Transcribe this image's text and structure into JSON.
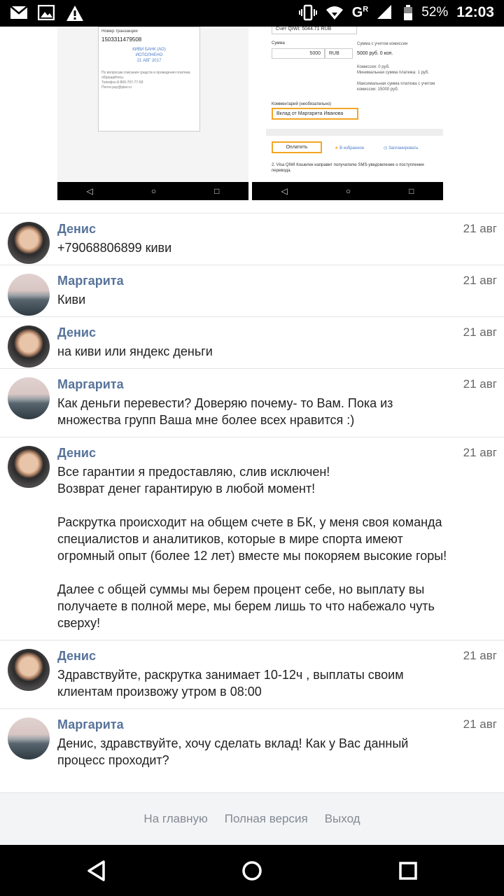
{
  "status_bar": {
    "battery": "52%",
    "time": "12:03",
    "network": "G",
    "network_sup": "R"
  },
  "attachment": {
    "left": {
      "label_top": "Номер транзакции",
      "number": "1503311479508",
      "bank": "КИВИ БАНК (АО)",
      "status": "ИСПОЛНЕНО",
      "date": "21 АВГ 2017",
      "support": "По вопросам списания средств и проведения платежа обращайтесь:",
      "phone_label": "Телефон",
      "phone": "8-800-707-77-59",
      "mail_label": "Почта",
      "mail": "pay@qiwi.ru"
    },
    "right": {
      "account": "Счет QIWI: 5044.71 RUB",
      "sum_label": "Сумма",
      "sum_value": "5000",
      "currency": "RUB",
      "with_fee_label": "Сумма с учетом комиссии",
      "with_fee_value": "5000 руб. 0 коп.",
      "fee_info": "Комиссия: 0 руб.",
      "min_info": "Минимальная сумма платежа: 1 руб.",
      "max_info": "Максимальная сумма платежа с учетом комиссии: 15000 руб.",
      "comment_label": "Комментарий (необязательно)",
      "comment_value": "Вклад от Маргарита Иванова",
      "pay_button": "Оплатить",
      "favorite": "В избранное",
      "schedule": "Запланировать",
      "sms_note": "2. Visa QIWI Кошелек направит получателю SMS-уведомление о поступлении перевода."
    }
  },
  "messages": [
    {
      "author": "Денис",
      "avatar": "denis",
      "date": "21 авг",
      "text": "+79068806899 киви"
    },
    {
      "author": "Маргарита",
      "avatar": "marg",
      "date": "21 авг",
      "text": "Киви"
    },
    {
      "author": "Денис",
      "avatar": "denis",
      "date": "21 авг",
      "text": "на киви или яндекс деньги"
    },
    {
      "author": "Маргарита",
      "avatar": "marg",
      "date": "21 авг",
      "text": "Как деньги перевести? Доверяю почему- то Вам. Пока из\nмножества групп Ваша мне более всех нравится :)"
    },
    {
      "author": "Денис",
      "avatar": "denis",
      "date": "21 авг",
      "text": "Все гарантии я предоставляю, слив исключен!\nВозврат денег гарантирую в любой момент!\n\nРаскрутка происходит на общем счете в БК, у меня своя команда\nспециалистов и аналитиков, которые в мире спорта имеют\nогромный опыт (более 12 лет) вместе мы покоряем высокие горы!\n\nДалее с общей суммы мы берем процент себе, но выплату вы\nполучаете в полной мере, мы берем лишь то что набежало чуть\nсверху!"
    },
    {
      "author": "Денис",
      "avatar": "denis",
      "date": "21 авг",
      "text": "Здравствуйте, раскрутка занимает 10-12ч , выплаты своим\nклиентам произвожу утром в 08:00"
    },
    {
      "author": "Маргарита",
      "avatar": "marg",
      "date": "21 авг",
      "text": "Денис, здравствуйте, хочу сделать вклад! Как у Вас данный\nпроцесс проходит?"
    }
  ],
  "footer": {
    "home": "На главную",
    "full": "Полная версия",
    "logout": "Выход"
  }
}
